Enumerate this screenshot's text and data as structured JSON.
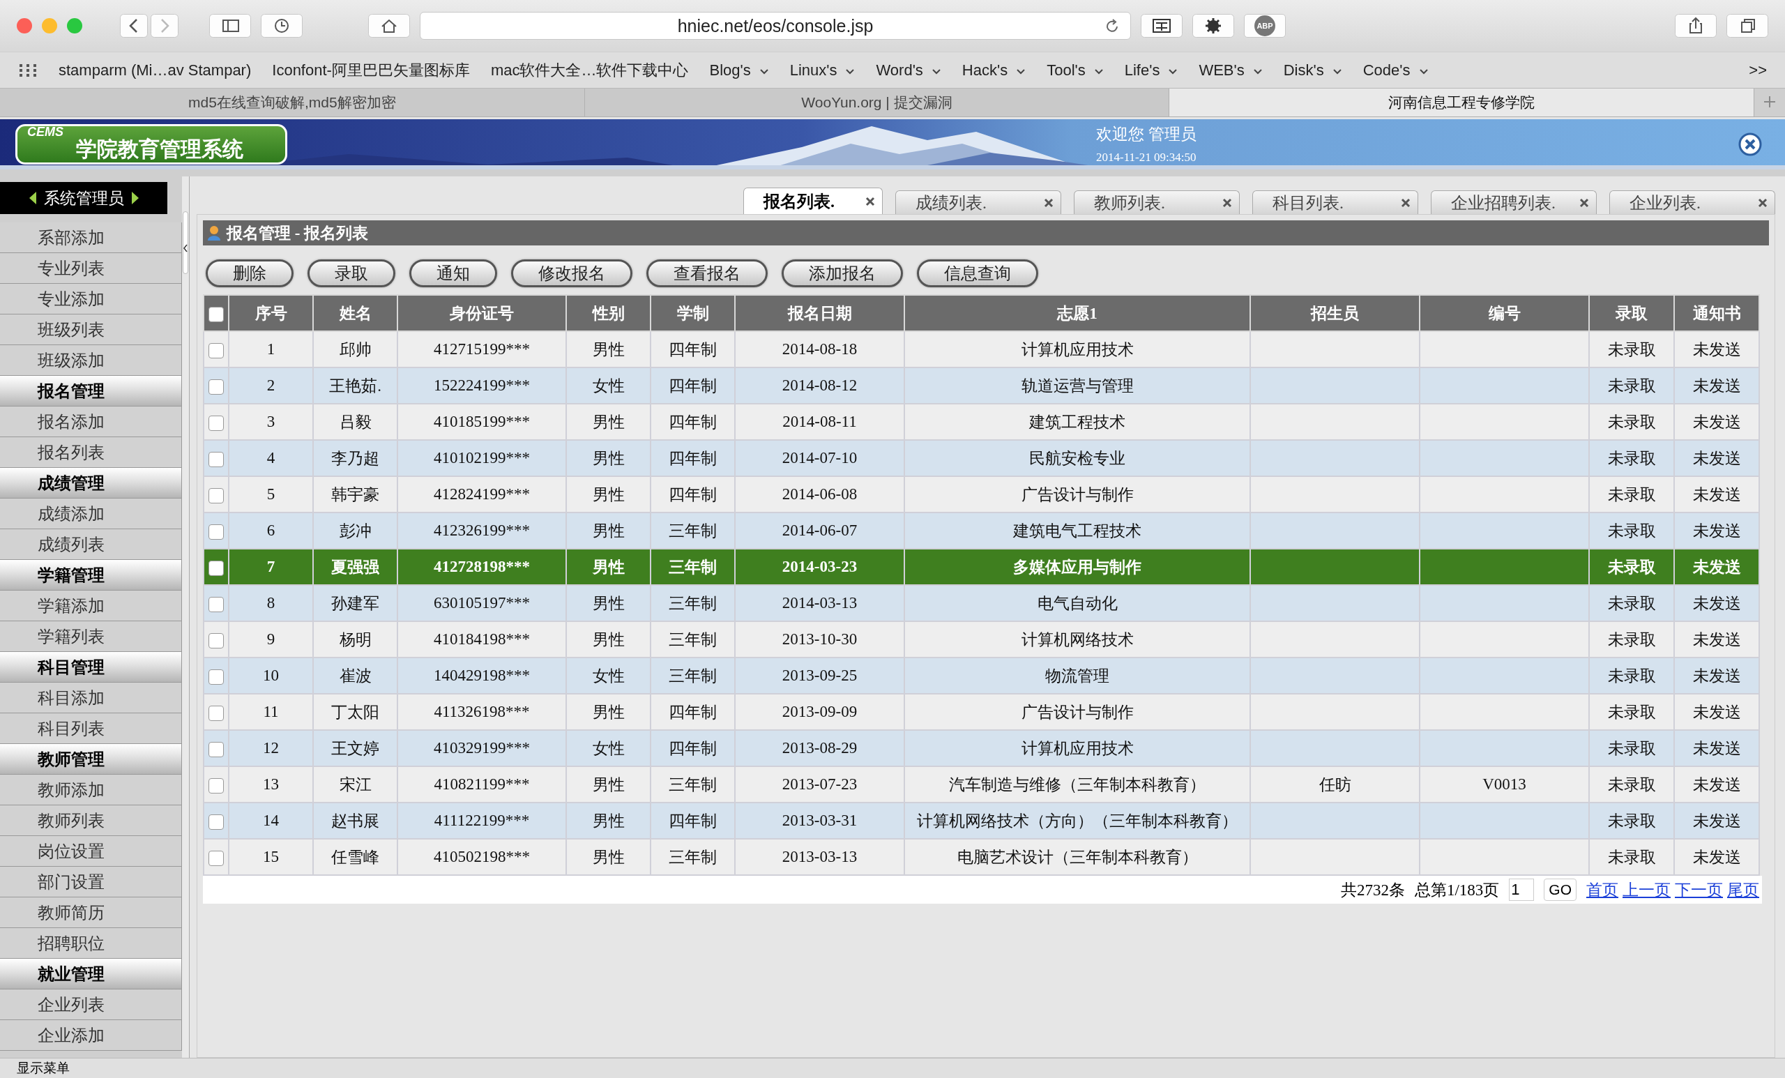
{
  "browser": {
    "url": "hniec.net/eos/console.jsp",
    "abp": "ABP",
    "bookmarks": [
      {
        "label": "stamparm (Mi…av Stampar)",
        "menu": false
      },
      {
        "label": "Iconfont-阿里巴巴矢量图标库",
        "menu": false
      },
      {
        "label": "mac软件大全…软件下载中心",
        "menu": false
      },
      {
        "label": "Blog's",
        "menu": true
      },
      {
        "label": "Linux's",
        "menu": true
      },
      {
        "label": "Word's",
        "menu": true
      },
      {
        "label": "Hack's",
        "menu": true
      },
      {
        "label": "Tool's",
        "menu": true
      },
      {
        "label": "Life's",
        "menu": true
      },
      {
        "label": "WEB's",
        "menu": true
      },
      {
        "label": "Disk's",
        "menu": true
      },
      {
        "label": "Code's",
        "menu": true
      }
    ],
    "more": ">>",
    "tabs": [
      {
        "label": "md5在线查询破解,md5解密加密",
        "selected": false
      },
      {
        "label": "WooYun.org | 提交漏洞",
        "selected": false
      },
      {
        "label": "河南信息工程专修学院",
        "selected": true
      }
    ]
  },
  "banner": {
    "logo_small": "CEMS",
    "logo": "学院教育管理系统",
    "welcome": "欢迎您 管理员",
    "time": "2014-11-21 09:34:50"
  },
  "sidebar": {
    "header": "系统管理员",
    "items": [
      {
        "label": "系部添加",
        "kind": "item"
      },
      {
        "label": "专业列表",
        "kind": "item"
      },
      {
        "label": "专业添加",
        "kind": "item"
      },
      {
        "label": "班级列表",
        "kind": "item"
      },
      {
        "label": "班级添加",
        "kind": "item"
      },
      {
        "label": "报名管理",
        "kind": "section"
      },
      {
        "label": "报名添加",
        "kind": "item"
      },
      {
        "label": "报名列表",
        "kind": "item"
      },
      {
        "label": "成绩管理",
        "kind": "section"
      },
      {
        "label": "成绩添加",
        "kind": "item"
      },
      {
        "label": "成绩列表",
        "kind": "item"
      },
      {
        "label": "学籍管理",
        "kind": "section"
      },
      {
        "label": "学籍添加",
        "kind": "item"
      },
      {
        "label": "学籍列表",
        "kind": "item"
      },
      {
        "label": "科目管理",
        "kind": "section"
      },
      {
        "label": "科目添加",
        "kind": "item"
      },
      {
        "label": "科目列表",
        "kind": "item"
      },
      {
        "label": "教师管理",
        "kind": "section"
      },
      {
        "label": "教师添加",
        "kind": "item"
      },
      {
        "label": "教师列表",
        "kind": "item"
      },
      {
        "label": "岗位设置",
        "kind": "item"
      },
      {
        "label": "部门设置",
        "kind": "item"
      },
      {
        "label": "教师简历",
        "kind": "item"
      },
      {
        "label": "招聘职位",
        "kind": "item"
      },
      {
        "label": "就业管理",
        "kind": "section"
      },
      {
        "label": "企业列表",
        "kind": "item"
      },
      {
        "label": "企业添加",
        "kind": "item"
      }
    ]
  },
  "tabs": [
    {
      "label": "报名列表.",
      "selected": true
    },
    {
      "label": "成绩列表.",
      "selected": false
    },
    {
      "label": "教师列表.",
      "selected": false
    },
    {
      "label": "科目列表.",
      "selected": false
    },
    {
      "label": "企业招聘列表.",
      "selected": false
    },
    {
      "label": "企业列表.",
      "selected": false
    }
  ],
  "breadcrumb": "报名管理 - 报名列表",
  "buttons": [
    "删除",
    "录取",
    "通知",
    "修改报名",
    "查看报名",
    "添加报名",
    "信息查询"
  ],
  "table": {
    "header_checked": false,
    "columns": [
      "序号",
      "姓名",
      "身份证号",
      "性别",
      "学制",
      "报名日期",
      "志愿1",
      "招生员",
      "编号",
      "录取",
      "通知书"
    ],
    "rows": [
      {
        "checked": false,
        "selected": false,
        "cells": [
          "1",
          "邱帅",
          "412715199***",
          "男性",
          "四年制",
          "2014-08-18",
          "计算机应用技术",
          null,
          null,
          "未录取",
          "未发送"
        ]
      },
      {
        "checked": false,
        "selected": false,
        "cells": [
          "2",
          "王艳茹.",
          "152224199***",
          "女性",
          "四年制",
          "2014-08-12",
          "轨道运营与管理",
          null,
          null,
          "未录取",
          "未发送"
        ]
      },
      {
        "checked": false,
        "selected": false,
        "cells": [
          "3",
          "吕毅",
          "410185199***",
          "男性",
          "四年制",
          "2014-08-11",
          "建筑工程技术",
          null,
          null,
          "未录取",
          "未发送"
        ]
      },
      {
        "checked": false,
        "selected": false,
        "cells": [
          "4",
          "李乃超",
          "410102199***",
          "男性",
          "四年制",
          "2014-07-10",
          "民航安检专业",
          null,
          null,
          "未录取",
          "未发送"
        ]
      },
      {
        "checked": false,
        "selected": false,
        "cells": [
          "5",
          "韩宇豪",
          "412824199***",
          "男性",
          "四年制",
          "2014-06-08",
          "广告设计与制作",
          null,
          null,
          "未录取",
          "未发送"
        ]
      },
      {
        "checked": false,
        "selected": false,
        "cells": [
          "6",
          "彭冲",
          "412326199***",
          "男性",
          "三年制",
          "2014-06-07",
          "建筑电气工程技术",
          null,
          null,
          "未录取",
          "未发送"
        ]
      },
      {
        "checked": false,
        "selected": true,
        "cells": [
          "7",
          "夏强强",
          "412728198***",
          "男性",
          "三年制",
          "2014-03-23",
          "多媒体应用与制作",
          null,
          null,
          "未录取",
          "未发送"
        ]
      },
      {
        "checked": false,
        "selected": false,
        "cells": [
          "8",
          "孙建军",
          "630105197***",
          "男性",
          "三年制",
          "2014-03-13",
          "电气自动化",
          null,
          null,
          "未录取",
          "未发送"
        ]
      },
      {
        "checked": false,
        "selected": false,
        "cells": [
          "9",
          "杨明",
          "410184198***",
          "男性",
          "三年制",
          "2013-10-30",
          "计算机网络技术",
          null,
          null,
          "未录取",
          "未发送"
        ]
      },
      {
        "checked": false,
        "selected": false,
        "cells": [
          "10",
          "崔波",
          "140429198***",
          "女性",
          "三年制",
          "2013-09-25",
          "物流管理",
          null,
          null,
          "未录取",
          "未发送"
        ]
      },
      {
        "checked": false,
        "selected": false,
        "cells": [
          "11",
          "丁太阳",
          "411326198***",
          "男性",
          "四年制",
          "2013-09-09",
          "广告设计与制作",
          null,
          null,
          "未录取",
          "未发送"
        ]
      },
      {
        "checked": false,
        "selected": false,
        "cells": [
          "12",
          "王文婷",
          "410329199***",
          "女性",
          "四年制",
          "2013-08-29",
          "计算机应用技术",
          null,
          null,
          "未录取",
          "未发送"
        ]
      },
      {
        "checked": false,
        "selected": false,
        "cells": [
          "13",
          "宋江",
          "410821199***",
          "男性",
          "三年制",
          "2013-07-23",
          "汽车制造与维修（三年制本科教育）",
          "任昉",
          "V0013",
          "未录取",
          "未发送"
        ]
      },
      {
        "checked": false,
        "selected": false,
        "cells": [
          "14",
          "赵书展",
          "411122199***",
          "男性",
          "四年制",
          "2013-03-31",
          "计算机网络技术（方向）（三年制本科教育）",
          null,
          null,
          "未录取",
          "未发送"
        ]
      },
      {
        "checked": false,
        "selected": false,
        "cells": [
          "15",
          "任雪峰",
          "410502198***",
          "男性",
          "三年制",
          "2013-03-13",
          "电脑艺术设计（三年制本科教育）",
          null,
          null,
          "未录取",
          "未发送"
        ]
      }
    ]
  },
  "pagination": {
    "total": "共2732条",
    "page": "总第1/183页",
    "page_input": "1",
    "go": "GO",
    "links": [
      "首页",
      "上一页",
      "下一页",
      "尾页"
    ]
  },
  "status_bar": "显示菜单"
}
